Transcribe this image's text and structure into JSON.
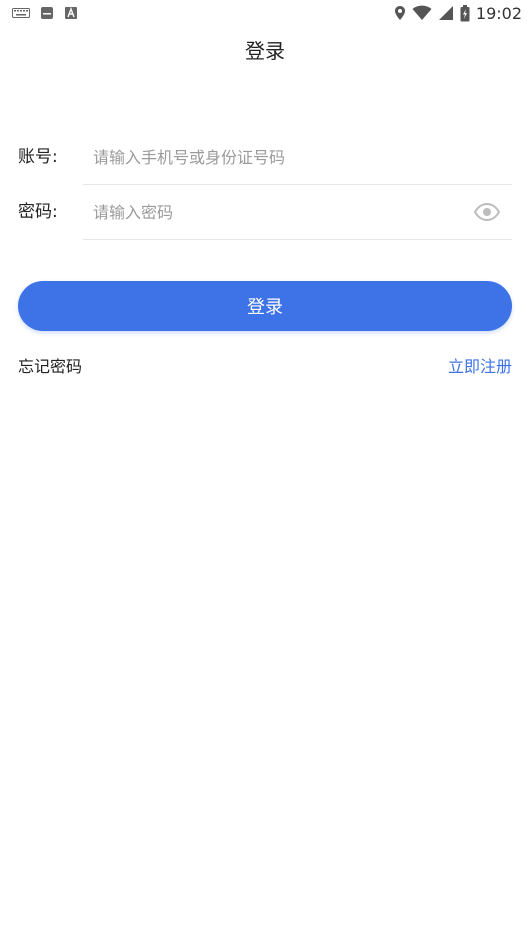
{
  "status_bar": {
    "time": "19:02",
    "left_icons": [
      "keyboard-icon",
      "notification-icon",
      "text-a-icon"
    ],
    "right_icons": [
      "location-icon",
      "wifi-icon",
      "signal-icon",
      "battery-icon"
    ]
  },
  "header": {
    "title": "登录"
  },
  "form": {
    "account_label": "账号:",
    "account_placeholder": "请输入手机号或身份证号码",
    "account_value": "",
    "password_label": "密码:",
    "password_placeholder": "请输入密码",
    "password_value": "",
    "password_toggle_icon": "eye-icon"
  },
  "actions": {
    "login_label": "登录",
    "forgot_label": "忘记密码",
    "register_label": "立即注册"
  },
  "colors": {
    "accent": "#3d73e7",
    "placeholder": "#9a9a9a",
    "divider": "#e6e6e6"
  }
}
